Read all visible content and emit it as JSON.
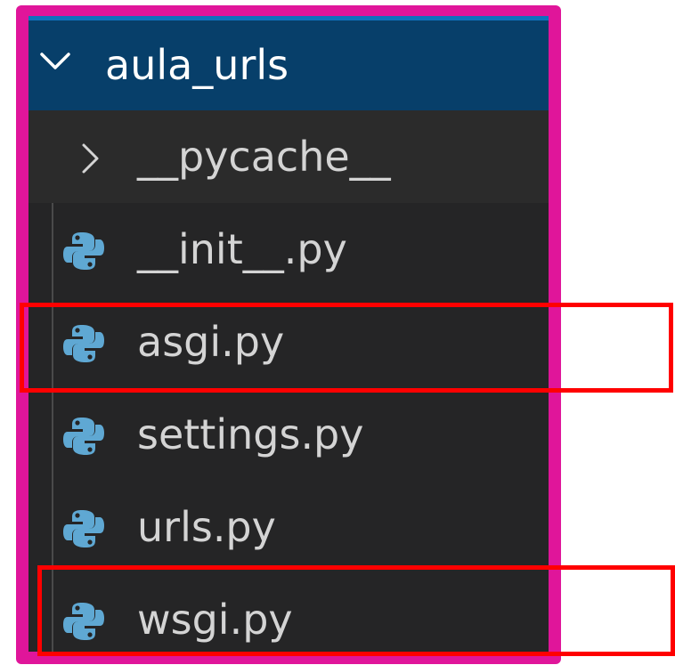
{
  "explorer": {
    "folder": {
      "name": "aula_urls",
      "expanded": true
    },
    "items": [
      {
        "label": "__pycache__",
        "type": "folder",
        "icon": "chevron-right-icon"
      },
      {
        "label": "__init__.py",
        "type": "python-file",
        "icon": "python-icon"
      },
      {
        "label": "asgi.py",
        "type": "python-file",
        "icon": "python-icon",
        "highlighted": true
      },
      {
        "label": "settings.py",
        "type": "python-file",
        "icon": "python-icon"
      },
      {
        "label": "urls.py",
        "type": "python-file",
        "icon": "python-icon"
      },
      {
        "label": "wsgi.py",
        "type": "python-file",
        "icon": "python-icon",
        "highlighted": true
      }
    ]
  },
  "colors": {
    "frame": "#e0159a",
    "highlight": "#ff0000",
    "header_bg": "#073f6a",
    "panel_bg": "#252526",
    "python_icon": "#5fa8d3"
  }
}
